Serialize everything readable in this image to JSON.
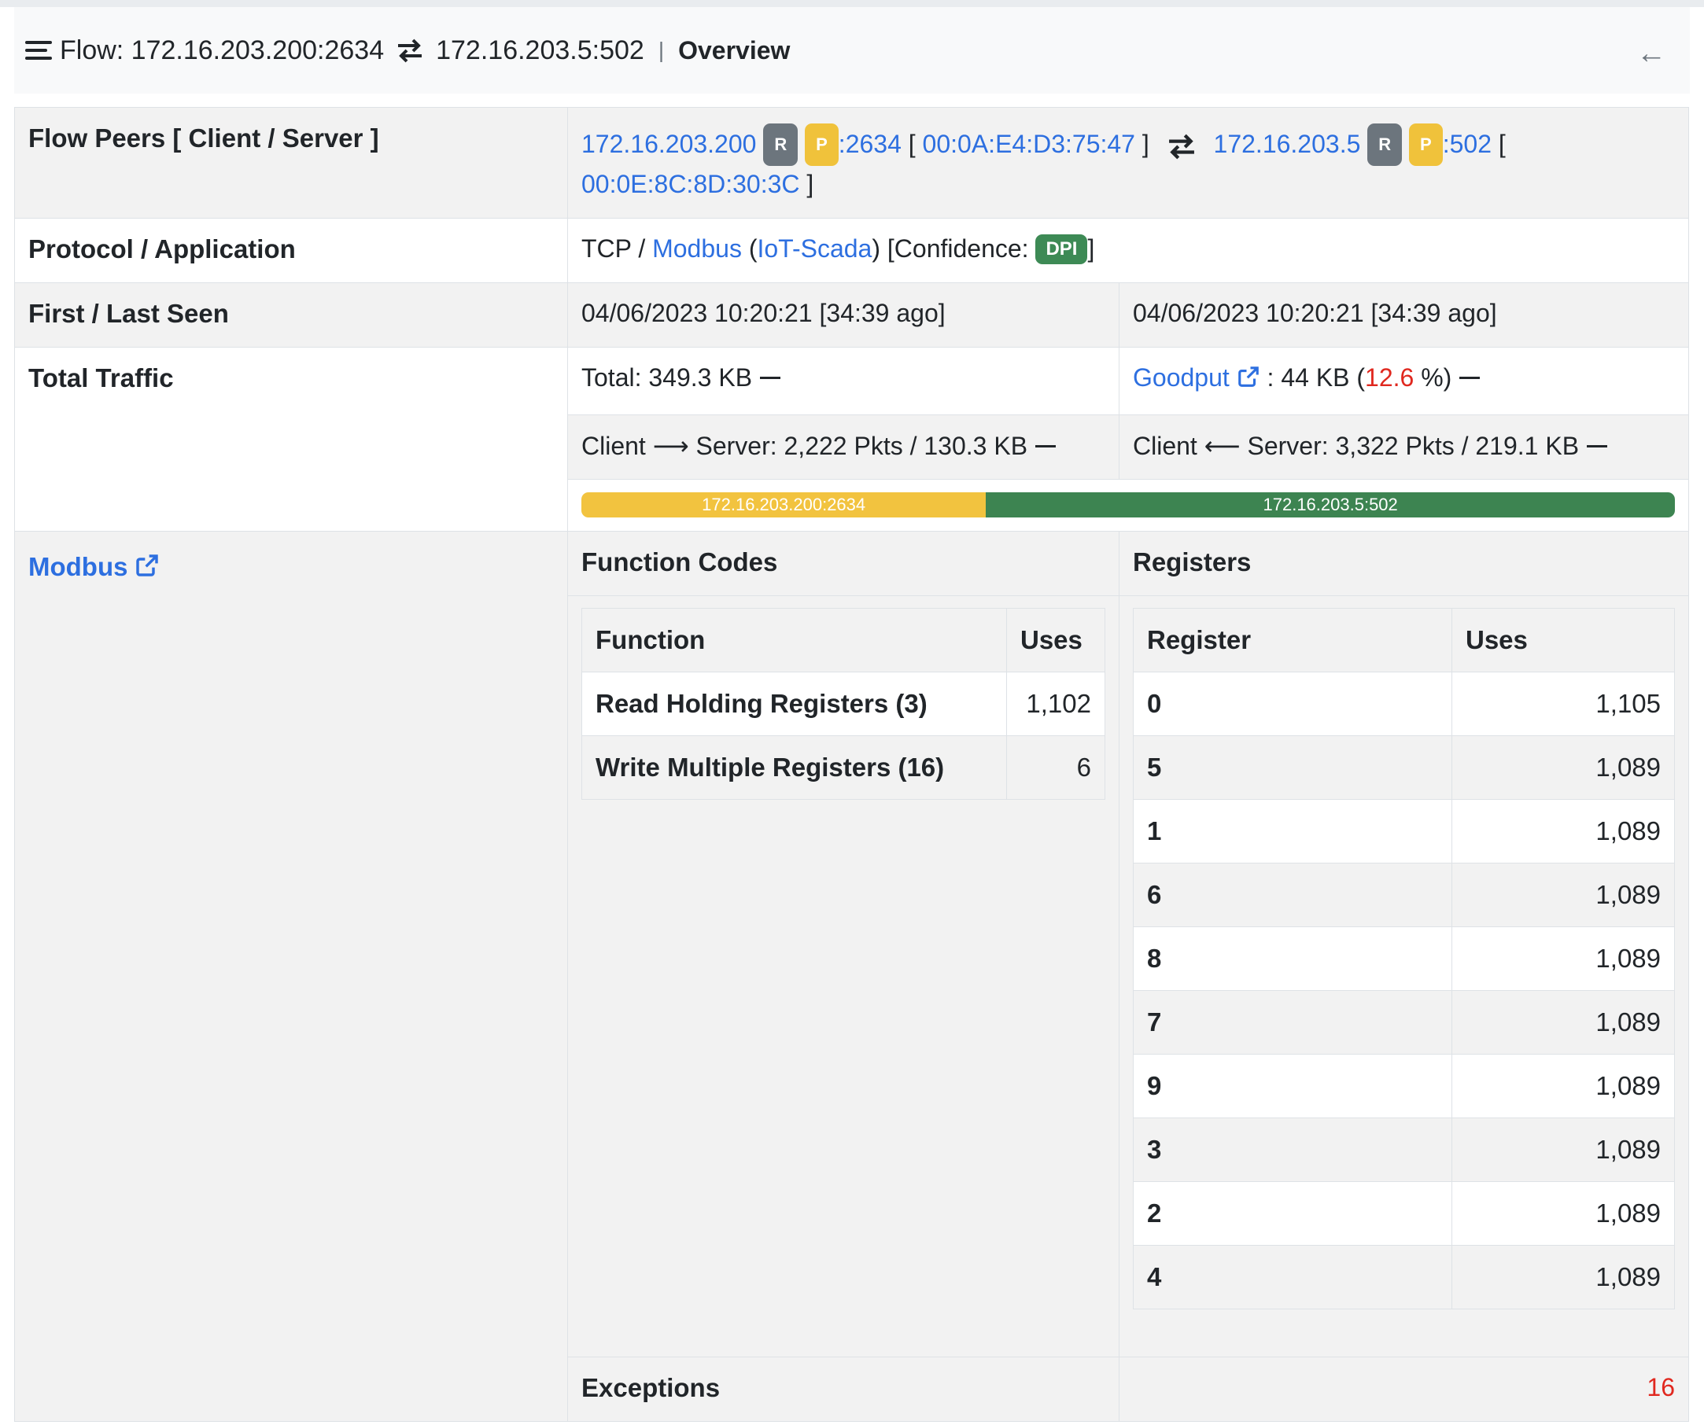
{
  "header": {
    "prefix": "Flow: 172.16.203.200:2634",
    "server": "172.16.203.5:502",
    "separator": "|",
    "section": "Overview"
  },
  "peers": {
    "label": "Flow Peers [ Client / Server ]",
    "client_ip": "172.16.203.200",
    "client_port": ":2634",
    "client_mac": "00:0A:E4:D3:75:47",
    "server_ip": "172.16.203.5",
    "server_port": ":502",
    "server_mac": "00:0E:8C:8D:30:3C",
    "badge_r": "R",
    "badge_p": "P",
    "open_bracket": "[",
    "close_bracket": "]"
  },
  "protocol": {
    "label": "Protocol / Application",
    "l4": "TCP / ",
    "app": "Modbus",
    "category": "IoT-Scada",
    "confidence_label": "[Confidence:",
    "confidence_badge": "DPI",
    "close": "]"
  },
  "seen": {
    "label": "First / Last Seen",
    "first": "04/06/2023 10:20:21 [34:39 ago]",
    "last": "04/06/2023 10:20:21 [34:39 ago]"
  },
  "traffic": {
    "label": "Total Traffic",
    "total": "Total: 349.3 KB",
    "goodput_link": "Goodput",
    "goodput_value": ": 44 KB (",
    "goodput_pct": "12.6",
    "goodput_suffix": " %)",
    "c2s_client": "Client",
    "c2s_rest": "Server: 2,222 Pkts / 130.3 KB",
    "s2c_client": "Client",
    "s2c_rest": "Server: 3,322 Pkts / 219.1 KB",
    "bar_client_label": "172.16.203.200:2634",
    "bar_server_label": "172.16.203.5:502",
    "bar_client_fraction": 0.37,
    "bar_client_color": "#f2c33f",
    "bar_server_color": "#3d8451"
  },
  "modbus": {
    "label": "Modbus",
    "function_codes_title": "Function Codes",
    "registers_title": "Registers",
    "functions_header": [
      "Function",
      "Uses"
    ],
    "functions": [
      {
        "name": "Read Holding Registers (3)",
        "uses": "1,102"
      },
      {
        "name": "Write Multiple Registers (16)",
        "uses": "6"
      }
    ],
    "registers_header": [
      "Register",
      "Uses"
    ],
    "registers": [
      {
        "reg": "0",
        "uses": "1,105"
      },
      {
        "reg": "5",
        "uses": "1,089"
      },
      {
        "reg": "1",
        "uses": "1,089"
      },
      {
        "reg": "6",
        "uses": "1,089"
      },
      {
        "reg": "8",
        "uses": "1,089"
      },
      {
        "reg": "7",
        "uses": "1,089"
      },
      {
        "reg": "9",
        "uses": "1,089"
      },
      {
        "reg": "3",
        "uses": "1,089"
      },
      {
        "reg": "2",
        "uses": "1,089"
      },
      {
        "reg": "4",
        "uses": "1,089"
      }
    ],
    "exceptions_label": "Exceptions",
    "exceptions_value": "16"
  },
  "colors": {
    "link": "#2d6fe0",
    "badge_r": "#6c757d",
    "badge_p": "#f0c23b",
    "badge_dpi": "#3d8a55",
    "alert_red": "#e0281f"
  }
}
